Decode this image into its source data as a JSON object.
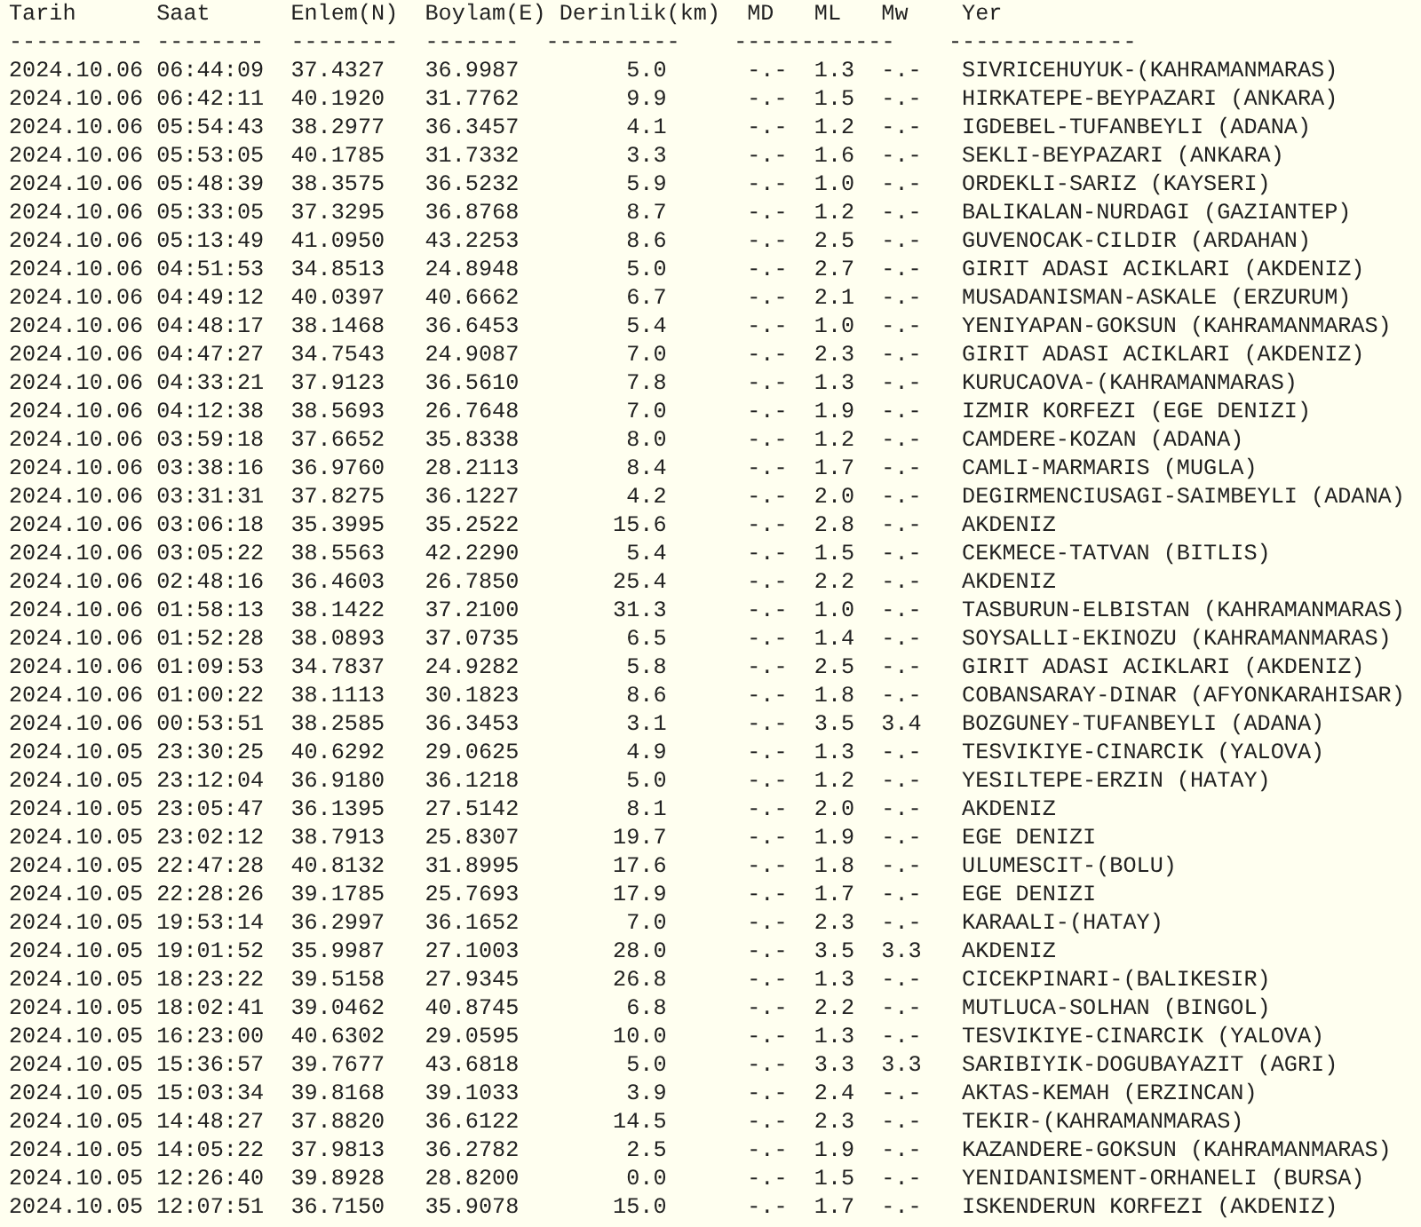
{
  "columns": [
    "Tarih",
    "Saat",
    "Enlem(N)",
    "Boylam(E)",
    "Derinlik(km)",
    "MD",
    "ML",
    "Mw",
    "Yer"
  ],
  "separators": [
    "----------",
    "--------",
    "--------",
    "-------",
    "----------",
    "------------",
    "--------------"
  ],
  "rows": [
    {
      "date": "2024.10.06",
      "time": "06:44:09",
      "lat": "37.4327",
      "lon": "36.9987",
      "depth": "5.0",
      "md": "-.-",
      "ml": "1.3",
      "mw": "-.-",
      "place": "SIVRICEHUYUK-(KAHRAMANMARAS)"
    },
    {
      "date": "2024.10.06",
      "time": "06:42:11",
      "lat": "40.1920",
      "lon": "31.7762",
      "depth": "9.9",
      "md": "-.-",
      "ml": "1.5",
      "mw": "-.-",
      "place": "HIRKATEPE-BEYPAZARI (ANKARA)"
    },
    {
      "date": "2024.10.06",
      "time": "05:54:43",
      "lat": "38.2977",
      "lon": "36.3457",
      "depth": "4.1",
      "md": "-.-",
      "ml": "1.2",
      "mw": "-.-",
      "place": "IGDEBEL-TUFANBEYLI (ADANA)"
    },
    {
      "date": "2024.10.06",
      "time": "05:53:05",
      "lat": "40.1785",
      "lon": "31.7332",
      "depth": "3.3",
      "md": "-.-",
      "ml": "1.6",
      "mw": "-.-",
      "place": "SEKLI-BEYPAZARI (ANKARA)"
    },
    {
      "date": "2024.10.06",
      "time": "05:48:39",
      "lat": "38.3575",
      "lon": "36.5232",
      "depth": "5.9",
      "md": "-.-",
      "ml": "1.0",
      "mw": "-.-",
      "place": "ORDEKLI-SARIZ (KAYSERI)"
    },
    {
      "date": "2024.10.06",
      "time": "05:33:05",
      "lat": "37.3295",
      "lon": "36.8768",
      "depth": "8.7",
      "md": "-.-",
      "ml": "1.2",
      "mw": "-.-",
      "place": "BALIKALAN-NURDAGI (GAZIANTEP)"
    },
    {
      "date": "2024.10.06",
      "time": "05:13:49",
      "lat": "41.0950",
      "lon": "43.2253",
      "depth": "8.6",
      "md": "-.-",
      "ml": "2.5",
      "mw": "-.-",
      "place": "GUVENOCAK-CILDIR (ARDAHAN)"
    },
    {
      "date": "2024.10.06",
      "time": "04:51:53",
      "lat": "34.8513",
      "lon": "24.8948",
      "depth": "5.0",
      "md": "-.-",
      "ml": "2.7",
      "mw": "-.-",
      "place": "GIRIT ADASI ACIKLARI (AKDENIZ)"
    },
    {
      "date": "2024.10.06",
      "time": "04:49:12",
      "lat": "40.0397",
      "lon": "40.6662",
      "depth": "6.7",
      "md": "-.-",
      "ml": "2.1",
      "mw": "-.-",
      "place": "MUSADANISMAN-ASKALE (ERZURUM)"
    },
    {
      "date": "2024.10.06",
      "time": "04:48:17",
      "lat": "38.1468",
      "lon": "36.6453",
      "depth": "5.4",
      "md": "-.-",
      "ml": "1.0",
      "mw": "-.-",
      "place": "YENIYAPAN-GOKSUN (KAHRAMANMARAS)"
    },
    {
      "date": "2024.10.06",
      "time": "04:47:27",
      "lat": "34.7543",
      "lon": "24.9087",
      "depth": "7.0",
      "md": "-.-",
      "ml": "2.3",
      "mw": "-.-",
      "place": "GIRIT ADASI ACIKLARI (AKDENIZ)"
    },
    {
      "date": "2024.10.06",
      "time": "04:33:21",
      "lat": "37.9123",
      "lon": "36.5610",
      "depth": "7.8",
      "md": "-.-",
      "ml": "1.3",
      "mw": "-.-",
      "place": "KURUCAOVA-(KAHRAMANMARAS)"
    },
    {
      "date": "2024.10.06",
      "time": "04:12:38",
      "lat": "38.5693",
      "lon": "26.7648",
      "depth": "7.0",
      "md": "-.-",
      "ml": "1.9",
      "mw": "-.-",
      "place": "IZMIR KORFEZI (EGE DENIZI)"
    },
    {
      "date": "2024.10.06",
      "time": "03:59:18",
      "lat": "37.6652",
      "lon": "35.8338",
      "depth": "8.0",
      "md": "-.-",
      "ml": "1.2",
      "mw": "-.-",
      "place": "CAMDERE-KOZAN (ADANA)"
    },
    {
      "date": "2024.10.06",
      "time": "03:38:16",
      "lat": "36.9760",
      "lon": "28.2113",
      "depth": "8.4",
      "md": "-.-",
      "ml": "1.7",
      "mw": "-.-",
      "place": "CAMLI-MARMARIS (MUGLA)"
    },
    {
      "date": "2024.10.06",
      "time": "03:31:31",
      "lat": "37.8275",
      "lon": "36.1227",
      "depth": "4.2",
      "md": "-.-",
      "ml": "2.0",
      "mw": "-.-",
      "place": "DEGIRMENCIUSAGI-SAIMBEYLI (ADANA)"
    },
    {
      "date": "2024.10.06",
      "time": "03:06:18",
      "lat": "35.3995",
      "lon": "35.2522",
      "depth": "15.6",
      "md": "-.-",
      "ml": "2.8",
      "mw": "-.-",
      "place": "AKDENIZ"
    },
    {
      "date": "2024.10.06",
      "time": "03:05:22",
      "lat": "38.5563",
      "lon": "42.2290",
      "depth": "5.4",
      "md": "-.-",
      "ml": "1.5",
      "mw": "-.-",
      "place": "CEKMECE-TATVAN (BITLIS)"
    },
    {
      "date": "2024.10.06",
      "time": "02:48:16",
      "lat": "36.4603",
      "lon": "26.7850",
      "depth": "25.4",
      "md": "-.-",
      "ml": "2.2",
      "mw": "-.-",
      "place": "AKDENIZ"
    },
    {
      "date": "2024.10.06",
      "time": "01:58:13",
      "lat": "38.1422",
      "lon": "37.2100",
      "depth": "31.3",
      "md": "-.-",
      "ml": "1.0",
      "mw": "-.-",
      "place": "TASBURUN-ELBISTAN (KAHRAMANMARAS)"
    },
    {
      "date": "2024.10.06",
      "time": "01:52:28",
      "lat": "38.0893",
      "lon": "37.0735",
      "depth": "6.5",
      "md": "-.-",
      "ml": "1.4",
      "mw": "-.-",
      "place": "SOYSALLI-EKINOZU (KAHRAMANMARAS)"
    },
    {
      "date": "2024.10.06",
      "time": "01:09:53",
      "lat": "34.7837",
      "lon": "24.9282",
      "depth": "5.8",
      "md": "-.-",
      "ml": "2.5",
      "mw": "-.-",
      "place": "GIRIT ADASI ACIKLARI (AKDENIZ)"
    },
    {
      "date": "2024.10.06",
      "time": "01:00:22",
      "lat": "38.1113",
      "lon": "30.1823",
      "depth": "8.6",
      "md": "-.-",
      "ml": "1.8",
      "mw": "-.-",
      "place": "COBANSARAY-DINAR (AFYONKARAHISAR)"
    },
    {
      "date": "2024.10.06",
      "time": "00:53:51",
      "lat": "38.2585",
      "lon": "36.3453",
      "depth": "3.1",
      "md": "-.-",
      "ml": "3.5",
      "mw": "3.4",
      "place": "BOZGUNEY-TUFANBEYLI (ADANA)"
    },
    {
      "date": "2024.10.05",
      "time": "23:30:25",
      "lat": "40.6292",
      "lon": "29.0625",
      "depth": "4.9",
      "md": "-.-",
      "ml": "1.3",
      "mw": "-.-",
      "place": "TESVIKIYE-CINARCIK (YALOVA)"
    },
    {
      "date": "2024.10.05",
      "time": "23:12:04",
      "lat": "36.9180",
      "lon": "36.1218",
      "depth": "5.0",
      "md": "-.-",
      "ml": "1.2",
      "mw": "-.-",
      "place": "YESILTEPE-ERZIN (HATAY)"
    },
    {
      "date": "2024.10.05",
      "time": "23:05:47",
      "lat": "36.1395",
      "lon": "27.5142",
      "depth": "8.1",
      "md": "-.-",
      "ml": "2.0",
      "mw": "-.-",
      "place": "AKDENIZ"
    },
    {
      "date": "2024.10.05",
      "time": "23:02:12",
      "lat": "38.7913",
      "lon": "25.8307",
      "depth": "19.7",
      "md": "-.-",
      "ml": "1.9",
      "mw": "-.-",
      "place": "EGE DENIZI"
    },
    {
      "date": "2024.10.05",
      "time": "22:47:28",
      "lat": "40.8132",
      "lon": "31.8995",
      "depth": "17.6",
      "md": "-.-",
      "ml": "1.8",
      "mw": "-.-",
      "place": "ULUMESCIT-(BOLU)"
    },
    {
      "date": "2024.10.05",
      "time": "22:28:26",
      "lat": "39.1785",
      "lon": "25.7693",
      "depth": "17.9",
      "md": "-.-",
      "ml": "1.7",
      "mw": "-.-",
      "place": "EGE DENIZI"
    },
    {
      "date": "2024.10.05",
      "time": "19:53:14",
      "lat": "36.2997",
      "lon": "36.1652",
      "depth": "7.0",
      "md": "-.-",
      "ml": "2.3",
      "mw": "-.-",
      "place": "KARAALI-(HATAY)"
    },
    {
      "date": "2024.10.05",
      "time": "19:01:52",
      "lat": "35.9987",
      "lon": "27.1003",
      "depth": "28.0",
      "md": "-.-",
      "ml": "3.5",
      "mw": "3.3",
      "place": "AKDENIZ"
    },
    {
      "date": "2024.10.05",
      "time": "18:23:22",
      "lat": "39.5158",
      "lon": "27.9345",
      "depth": "26.8",
      "md": "-.-",
      "ml": "1.3",
      "mw": "-.-",
      "place": "CICEKPINARI-(BALIKESIR)"
    },
    {
      "date": "2024.10.05",
      "time": "18:02:41",
      "lat": "39.0462",
      "lon": "40.8745",
      "depth": "6.8",
      "md": "-.-",
      "ml": "2.2",
      "mw": "-.-",
      "place": "MUTLUCA-SOLHAN (BINGOL)"
    },
    {
      "date": "2024.10.05",
      "time": "16:23:00",
      "lat": "40.6302",
      "lon": "29.0595",
      "depth": "10.0",
      "md": "-.-",
      "ml": "1.3",
      "mw": "-.-",
      "place": "TESVIKIYE-CINARCIK (YALOVA)"
    },
    {
      "date": "2024.10.05",
      "time": "15:36:57",
      "lat": "39.7677",
      "lon": "43.6818",
      "depth": "5.0",
      "md": "-.-",
      "ml": "3.3",
      "mw": "3.3",
      "place": "SARIBIYIK-DOGUBAYAZIT (AGRI)"
    },
    {
      "date": "2024.10.05",
      "time": "15:03:34",
      "lat": "39.8168",
      "lon": "39.1033",
      "depth": "3.9",
      "md": "-.-",
      "ml": "2.4",
      "mw": "-.-",
      "place": "AKTAS-KEMAH (ERZINCAN)"
    },
    {
      "date": "2024.10.05",
      "time": "14:48:27",
      "lat": "37.8820",
      "lon": "36.6122",
      "depth": "14.5",
      "md": "-.-",
      "ml": "2.3",
      "mw": "-.-",
      "place": "TEKIR-(KAHRAMANMARAS)"
    },
    {
      "date": "2024.10.05",
      "time": "14:05:22",
      "lat": "37.9813",
      "lon": "36.2782",
      "depth": "2.5",
      "md": "-.-",
      "ml": "1.9",
      "mw": "-.-",
      "place": "KAZANDERE-GOKSUN (KAHRAMANMARAS)"
    },
    {
      "date": "2024.10.05",
      "time": "12:26:40",
      "lat": "39.8928",
      "lon": "28.8200",
      "depth": "0.0",
      "md": "-.-",
      "ml": "1.5",
      "mw": "-.-",
      "place": "YENIDANISMENT-ORHANELI (BURSA)"
    },
    {
      "date": "2024.10.05",
      "time": "12:07:51",
      "lat": "36.7150",
      "lon": "35.9078",
      "depth": "15.0",
      "md": "-.-",
      "ml": "1.7",
      "mw": "-.-",
      "place": "ISKENDERUN KORFEZI (AKDENIZ)"
    }
  ]
}
